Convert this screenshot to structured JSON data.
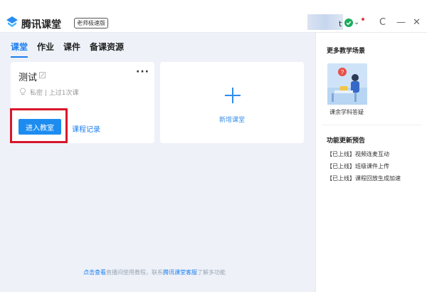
{
  "window": {
    "app_title": "腾讯课堂",
    "badge": "老师极速版",
    "user_name_partial": "t",
    "controls": {
      "refresh": "C",
      "minimize": "—",
      "close": "✕"
    },
    "icons": [
      "logo-icon",
      "shield-check-icon",
      "chevron-down-icon",
      "notification-dot",
      "refresh-icon",
      "minimize-icon",
      "close-icon"
    ]
  },
  "tabs": [
    "课堂",
    "作业",
    "课件",
    "备课资源"
  ],
  "classroom_card": {
    "title": "测试",
    "more": "···",
    "meta": "私密  |  上过1次课",
    "enter_button": "进入教室",
    "record_link": "课程记录"
  },
  "new_card": {
    "label": "新增课堂"
  },
  "footer": {
    "prefix": "点击查看",
    "middle": "直播间使用教程，联系",
    "service": "腾讯课堂客服",
    "suffix": "了解多功能"
  },
  "right_panel": {
    "scenes_title": "更多教学场景",
    "scene_label": "课余学科答疑",
    "updates_title": "功能更新预告",
    "updates": [
      "【已上线】视频连麦互动",
      "【已上线】班级课件上传",
      "【已上线】课程回放生成加速"
    ]
  },
  "colors": {
    "accent": "#1b7ef0",
    "highlight_box": "#d9162a",
    "background": "#eef2f8"
  }
}
